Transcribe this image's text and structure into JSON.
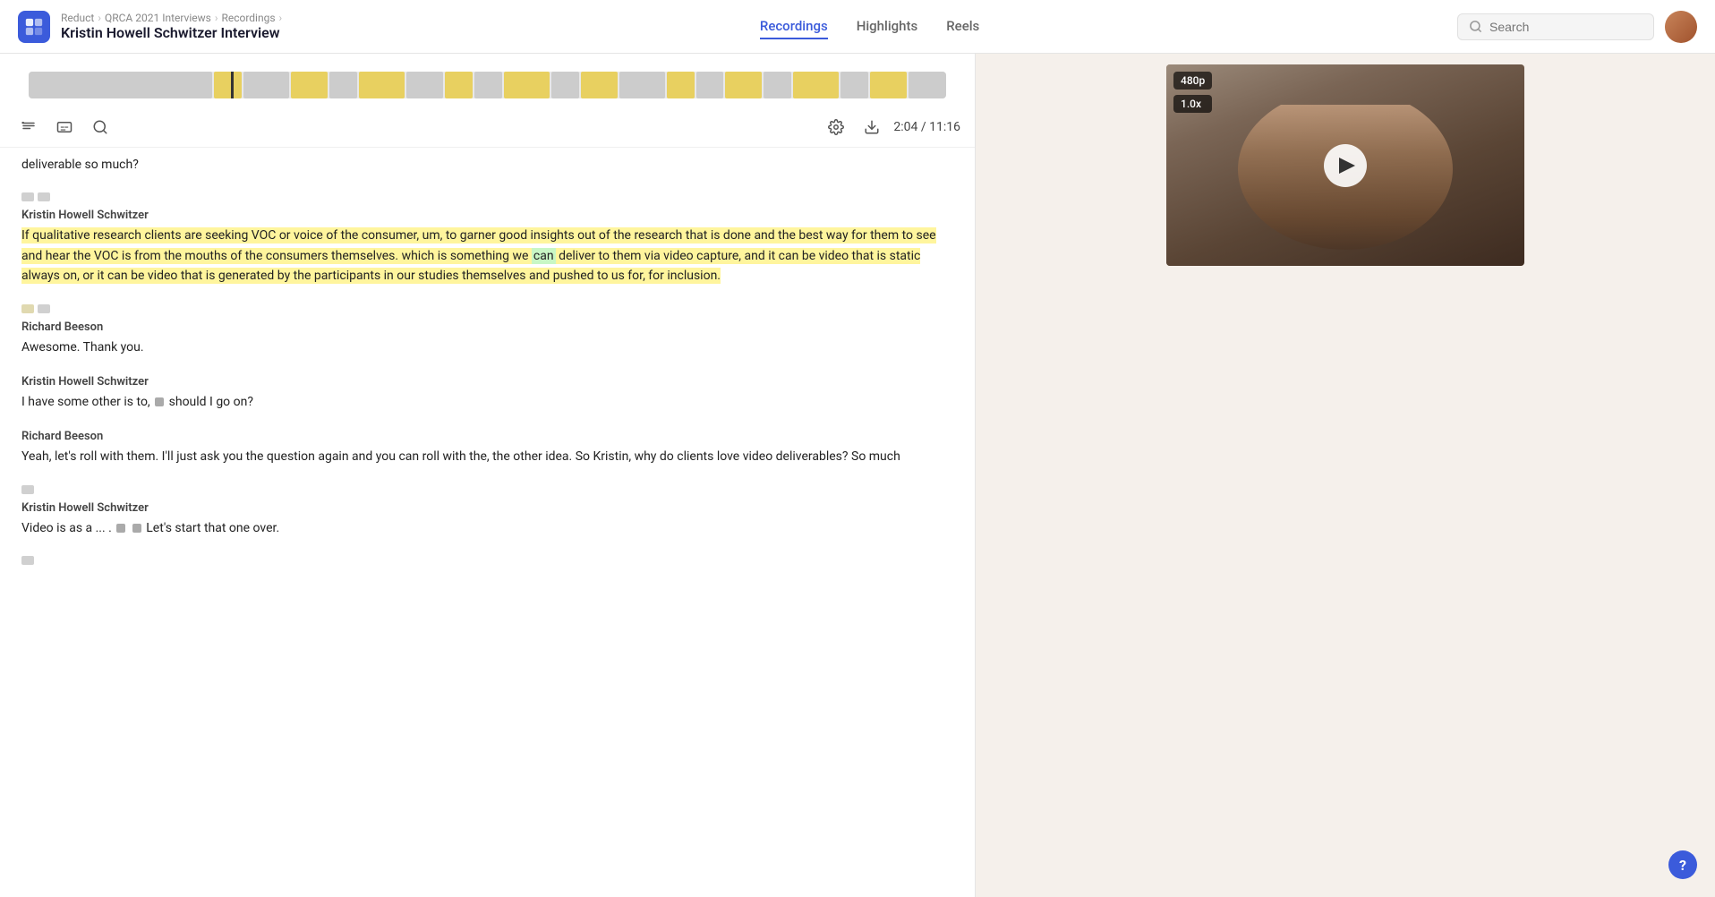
{
  "app": {
    "logo_alt": "Reduct logo"
  },
  "breadcrumb": {
    "root": "Reduct",
    "level1": "QRCA 2021 Interviews",
    "level2": "Recordings",
    "title": "Kristin Howell Schwitzer Interview"
  },
  "nav": {
    "tabs": [
      {
        "id": "recordings",
        "label": "Recordings",
        "active": true
      },
      {
        "id": "highlights",
        "label": "Highlights",
        "active": false
      },
      {
        "id": "reels",
        "label": "Reels",
        "active": false
      }
    ],
    "search_placeholder": "Search"
  },
  "toolbar": {
    "time_display": "2:04 / 11:16"
  },
  "transcript": {
    "blocks": [
      {
        "id": "block0",
        "speaker": "",
        "text": "deliverable so much?",
        "type": "continuation"
      },
      {
        "id": "block1",
        "speaker": "Kristin Howell Schwitzer",
        "text": "If qualitative research clients are seeking VOC or voice of the consumer, um, to garner good insights out of the research that is done and the best way for them to see and hear the VOC is from the mouths of the consumers themselves. which is something we can deliver to them via video capture, and it can be video that is static always on, or it can be video that is generated by the participants in our studies themselves and pushed to us for, for inclusion.",
        "highlighted": true,
        "highlight_word": "can"
      },
      {
        "id": "block2",
        "speaker": "Richard Beeson",
        "text": "Awesome. Thank you."
      },
      {
        "id": "block3",
        "speaker": "Kristin Howell Schwitzer",
        "text": "I have some other is to, [redacted] should I go on?"
      },
      {
        "id": "block4",
        "speaker": "Richard Beeson",
        "text": "Yeah, let's roll with them. I'll just ask you the question again and you can roll with the, the other idea. So Kristin, why do clients love video deliverables? So much"
      },
      {
        "id": "block5",
        "speaker": "Kristin Howell Schwitzer",
        "text": "Video is as a  ... . [redacted] [redacted] Let's start that one over."
      }
    ]
  },
  "video": {
    "quality_badge": "480p",
    "speed_badge": "1.0x"
  }
}
